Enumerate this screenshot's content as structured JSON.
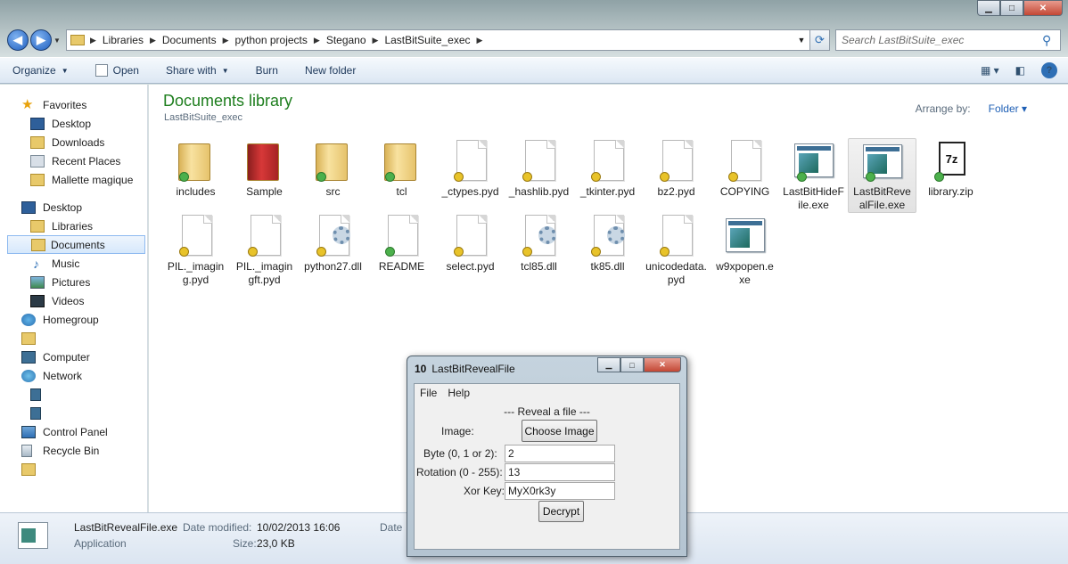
{
  "address": {
    "crumbs": [
      "Libraries",
      "Documents",
      "python projects",
      "Stegano",
      "LastBitSuite_exec"
    ],
    "search_placeholder": "Search LastBitSuite_exec"
  },
  "toolbar": {
    "organize": "Organize",
    "open": "Open",
    "share": "Share with",
    "burn": "Burn",
    "new_folder": "New folder"
  },
  "sidebar": {
    "favorites": "Favorites",
    "desktop": "Desktop",
    "downloads": "Downloads",
    "recent": "Recent Places",
    "mallette": "Mallette magique",
    "desktop2": "Desktop",
    "libraries": "Libraries",
    "documents": "Documents",
    "music": "Music",
    "pictures": "Pictures",
    "videos": "Videos",
    "homegroup": "Homegroup",
    "computer": "Computer",
    "network": "Network",
    "control_panel": "Control Panel",
    "recycle": "Recycle Bin"
  },
  "main": {
    "title": "Documents library",
    "subtitle": "LastBitSuite_exec",
    "arrange_label": "Arrange by:",
    "arrange_value": "Folder ▾"
  },
  "files": [
    {
      "name": "includes",
      "kind": "folder",
      "badge": "ok"
    },
    {
      "name": "Sample",
      "kind": "folder-red",
      "badge": "none"
    },
    {
      "name": "src",
      "kind": "folder",
      "badge": "ok"
    },
    {
      "name": "tcl",
      "kind": "folder",
      "badge": "ok"
    },
    {
      "name": "_ctypes.pyd",
      "kind": "doc",
      "badge": "warn"
    },
    {
      "name": "_hashlib.pyd",
      "kind": "doc",
      "badge": "warn"
    },
    {
      "name": "_tkinter.pyd",
      "kind": "doc",
      "badge": "warn"
    },
    {
      "name": "bz2.pyd",
      "kind": "doc",
      "badge": "warn"
    },
    {
      "name": "COPYING",
      "kind": "doc",
      "badge": "warn"
    },
    {
      "name": "LastBitHideFile.exe",
      "kind": "exe",
      "badge": "ok"
    },
    {
      "name": "LastBitRevealFile.exe",
      "kind": "exe",
      "badge": "ok",
      "selected": true
    },
    {
      "name": "library.zip",
      "kind": "zip",
      "badge": "ok"
    },
    {
      "name": "PIL._imaging.pyd",
      "kind": "doc",
      "badge": "warn"
    },
    {
      "name": "PIL._imagingft.pyd",
      "kind": "doc",
      "badge": "warn"
    },
    {
      "name": "python27.dll",
      "kind": "dll",
      "badge": "warn"
    },
    {
      "name": "README",
      "kind": "doc",
      "badge": "ok"
    },
    {
      "name": "select.pyd",
      "kind": "doc",
      "badge": "warn"
    },
    {
      "name": "tcl85.dll",
      "kind": "dll",
      "badge": "warn"
    },
    {
      "name": "tk85.dll",
      "kind": "dll",
      "badge": "warn"
    },
    {
      "name": "unicodedata.pyd",
      "kind": "doc",
      "badge": "warn"
    },
    {
      "name": "w9xpopen.exe",
      "kind": "exe",
      "badge": "none"
    }
  ],
  "status": {
    "name": "LastBitRevealFile.exe",
    "type": "Application",
    "modified_label": "Date modified:",
    "modified": "10/02/2013 16:06",
    "size_label": "Size:",
    "size": "23,0 KB",
    "date_label": "Date"
  },
  "dialog": {
    "icon": "10",
    "title": "LastBitRevealFile",
    "menu_file": "File",
    "menu_help": "Help",
    "heading": "--- Reveal a file ---",
    "image_label": "Image:",
    "choose_button": "Choose Image",
    "byte_label": "Byte (0, 1 or 2):",
    "byte_value": "2",
    "rotation_label": "Rotation (0 - 255):",
    "rotation_value": "13",
    "xor_label": "Xor Key:",
    "xor_value": "MyX0rk3y",
    "decrypt_button": "Decrypt"
  }
}
